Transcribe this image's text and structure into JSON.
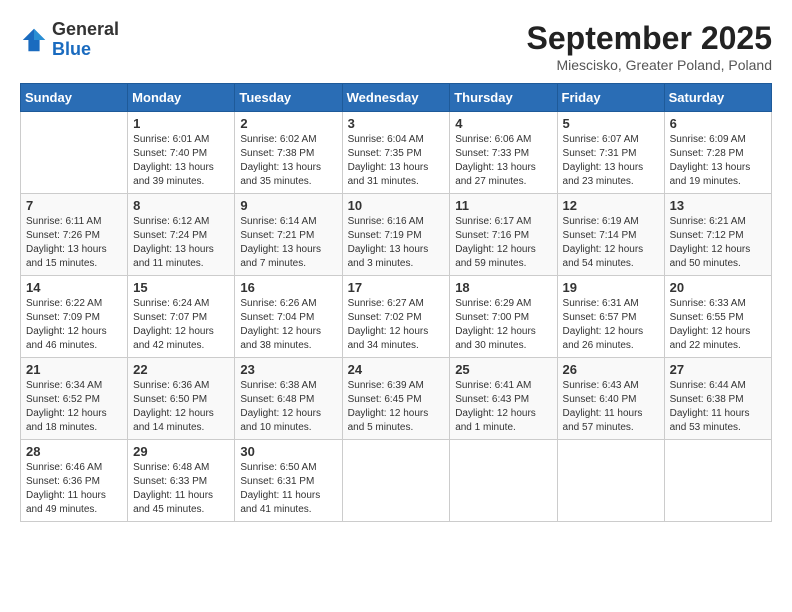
{
  "logo": {
    "general": "General",
    "blue": "Blue"
  },
  "title": "September 2025",
  "location": "Miescisko, Greater Poland, Poland",
  "days_of_week": [
    "Sunday",
    "Monday",
    "Tuesday",
    "Wednesday",
    "Thursday",
    "Friday",
    "Saturday"
  ],
  "weeks": [
    [
      {
        "day": null,
        "info": null
      },
      {
        "day": "1",
        "info": "Sunrise: 6:01 AM\nSunset: 7:40 PM\nDaylight: 13 hours and 39 minutes."
      },
      {
        "day": "2",
        "info": "Sunrise: 6:02 AM\nSunset: 7:38 PM\nDaylight: 13 hours and 35 minutes."
      },
      {
        "day": "3",
        "info": "Sunrise: 6:04 AM\nSunset: 7:35 PM\nDaylight: 13 hours and 31 minutes."
      },
      {
        "day": "4",
        "info": "Sunrise: 6:06 AM\nSunset: 7:33 PM\nDaylight: 13 hours and 27 minutes."
      },
      {
        "day": "5",
        "info": "Sunrise: 6:07 AM\nSunset: 7:31 PM\nDaylight: 13 hours and 23 minutes."
      },
      {
        "day": "6",
        "info": "Sunrise: 6:09 AM\nSunset: 7:28 PM\nDaylight: 13 hours and 19 minutes."
      }
    ],
    [
      {
        "day": "7",
        "info": "Sunrise: 6:11 AM\nSunset: 7:26 PM\nDaylight: 13 hours and 15 minutes."
      },
      {
        "day": "8",
        "info": "Sunrise: 6:12 AM\nSunset: 7:24 PM\nDaylight: 13 hours and 11 minutes."
      },
      {
        "day": "9",
        "info": "Sunrise: 6:14 AM\nSunset: 7:21 PM\nDaylight: 13 hours and 7 minutes."
      },
      {
        "day": "10",
        "info": "Sunrise: 6:16 AM\nSunset: 7:19 PM\nDaylight: 13 hours and 3 minutes."
      },
      {
        "day": "11",
        "info": "Sunrise: 6:17 AM\nSunset: 7:16 PM\nDaylight: 12 hours and 59 minutes."
      },
      {
        "day": "12",
        "info": "Sunrise: 6:19 AM\nSunset: 7:14 PM\nDaylight: 12 hours and 54 minutes."
      },
      {
        "day": "13",
        "info": "Sunrise: 6:21 AM\nSunset: 7:12 PM\nDaylight: 12 hours and 50 minutes."
      }
    ],
    [
      {
        "day": "14",
        "info": "Sunrise: 6:22 AM\nSunset: 7:09 PM\nDaylight: 12 hours and 46 minutes."
      },
      {
        "day": "15",
        "info": "Sunrise: 6:24 AM\nSunset: 7:07 PM\nDaylight: 12 hours and 42 minutes."
      },
      {
        "day": "16",
        "info": "Sunrise: 6:26 AM\nSunset: 7:04 PM\nDaylight: 12 hours and 38 minutes."
      },
      {
        "day": "17",
        "info": "Sunrise: 6:27 AM\nSunset: 7:02 PM\nDaylight: 12 hours and 34 minutes."
      },
      {
        "day": "18",
        "info": "Sunrise: 6:29 AM\nSunset: 7:00 PM\nDaylight: 12 hours and 30 minutes."
      },
      {
        "day": "19",
        "info": "Sunrise: 6:31 AM\nSunset: 6:57 PM\nDaylight: 12 hours and 26 minutes."
      },
      {
        "day": "20",
        "info": "Sunrise: 6:33 AM\nSunset: 6:55 PM\nDaylight: 12 hours and 22 minutes."
      }
    ],
    [
      {
        "day": "21",
        "info": "Sunrise: 6:34 AM\nSunset: 6:52 PM\nDaylight: 12 hours and 18 minutes."
      },
      {
        "day": "22",
        "info": "Sunrise: 6:36 AM\nSunset: 6:50 PM\nDaylight: 12 hours and 14 minutes."
      },
      {
        "day": "23",
        "info": "Sunrise: 6:38 AM\nSunset: 6:48 PM\nDaylight: 12 hours and 10 minutes."
      },
      {
        "day": "24",
        "info": "Sunrise: 6:39 AM\nSunset: 6:45 PM\nDaylight: 12 hours and 5 minutes."
      },
      {
        "day": "25",
        "info": "Sunrise: 6:41 AM\nSunset: 6:43 PM\nDaylight: 12 hours and 1 minute."
      },
      {
        "day": "26",
        "info": "Sunrise: 6:43 AM\nSunset: 6:40 PM\nDaylight: 11 hours and 57 minutes."
      },
      {
        "day": "27",
        "info": "Sunrise: 6:44 AM\nSunset: 6:38 PM\nDaylight: 11 hours and 53 minutes."
      }
    ],
    [
      {
        "day": "28",
        "info": "Sunrise: 6:46 AM\nSunset: 6:36 PM\nDaylight: 11 hours and 49 minutes."
      },
      {
        "day": "29",
        "info": "Sunrise: 6:48 AM\nSunset: 6:33 PM\nDaylight: 11 hours and 45 minutes."
      },
      {
        "day": "30",
        "info": "Sunrise: 6:50 AM\nSunset: 6:31 PM\nDaylight: 11 hours and 41 minutes."
      },
      {
        "day": null,
        "info": null
      },
      {
        "day": null,
        "info": null
      },
      {
        "day": null,
        "info": null
      },
      {
        "day": null,
        "info": null
      }
    ]
  ]
}
